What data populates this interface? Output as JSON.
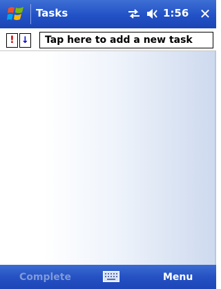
{
  "titlebar": {
    "app_title": "Tasks",
    "clock": "1:56",
    "close_glyph": "✕",
    "icons": [
      "windows-start-icon",
      "connectivity-icon",
      "volume-icon"
    ]
  },
  "entrybar": {
    "priority_glyph": "!",
    "sort_glyph": "↓",
    "input_text": "Tap here to add a new task"
  },
  "menubar": {
    "left_softkey": "Complete",
    "left_softkey_enabled": false,
    "right_softkey": "Menu",
    "icons": [
      "keyboard-icon"
    ]
  },
  "colors": {
    "titlebar": "#2251c6",
    "menubar": "#2551c4",
    "priority": "#c00000",
    "sort": "#0000cc",
    "disabled_text": "#7f9ad8"
  }
}
